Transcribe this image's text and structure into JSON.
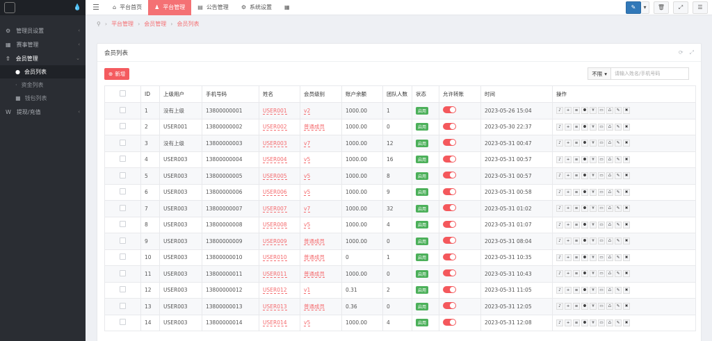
{
  "sidebar": {
    "items": [
      {
        "label": "管理员设置",
        "icon": "wrench-icon"
      },
      {
        "label": "赛事管理",
        "icon": "grid-icon"
      },
      {
        "label": "会员管理",
        "icon": "user-icon"
      },
      {
        "label": "提现/充值",
        "icon": "wallet-icon"
      }
    ],
    "subitems": [
      {
        "label": "会员列表",
        "icon": "users-icon"
      },
      {
        "label": "资金列表",
        "icon": "dot-icon"
      },
      {
        "label": "钱包列表",
        "icon": "wallet-icon"
      }
    ]
  },
  "topbar": {
    "tabs": [
      {
        "label": "平台首页",
        "icon": "home-icon"
      },
      {
        "label": "平台管理",
        "icon": "person-icon"
      },
      {
        "label": "公告管理",
        "icon": "notice-icon"
      },
      {
        "label": "系统设置",
        "icon": "gear-icon"
      }
    ]
  },
  "breadcrumb": [
    "平台管理",
    "会员管理",
    "会员列表"
  ],
  "panel": {
    "title": "会员列表",
    "add_label": "新增",
    "filter_label": "不限",
    "search_placeholder": "请输入姓名/手机号码"
  },
  "table": {
    "headers": [
      "ID",
      "上级用户",
      "手机号码",
      "姓名",
      "会员级别",
      "账户余额",
      "团队人数",
      "状态",
      "允许转账",
      "时间",
      "操作"
    ],
    "status_label": "启用",
    "rows": [
      {
        "id": "1",
        "parent": "没有上级",
        "phone": "13800000001",
        "name": "USER001",
        "level": "v2",
        "balance": "1000.00",
        "team": "1",
        "time": "2023-05-26 15:04"
      },
      {
        "id": "2",
        "parent": "USER001",
        "phone": "13800000002",
        "name": "USER002",
        "level": "普通成员",
        "balance": "1000.00",
        "team": "0",
        "time": "2023-05-30 22:37"
      },
      {
        "id": "3",
        "parent": "没有上级",
        "phone": "13800000003",
        "name": "USER003",
        "level": "v7",
        "balance": "1000.00",
        "team": "12",
        "time": "2023-05-31 00:47"
      },
      {
        "id": "4",
        "parent": "USER003",
        "phone": "13800000004",
        "name": "USER004",
        "level": "v5",
        "balance": "1000.00",
        "team": "16",
        "time": "2023-05-31 00:57"
      },
      {
        "id": "5",
        "parent": "USER003",
        "phone": "13800000005",
        "name": "USER005",
        "level": "v5",
        "balance": "1000.00",
        "team": "8",
        "time": "2023-05-31 00:57"
      },
      {
        "id": "6",
        "parent": "USER003",
        "phone": "13800000006",
        "name": "USER006",
        "level": "v5",
        "balance": "1000.00",
        "team": "9",
        "time": "2023-05-31 00:58"
      },
      {
        "id": "7",
        "parent": "USER003",
        "phone": "13800000007",
        "name": "USER007",
        "level": "v7",
        "balance": "1000.00",
        "team": "32",
        "time": "2023-05-31 01:02"
      },
      {
        "id": "8",
        "parent": "USER003",
        "phone": "13800000008",
        "name": "USER008",
        "level": "v5",
        "balance": "1000.00",
        "team": "4",
        "time": "2023-05-31 01:07"
      },
      {
        "id": "9",
        "parent": "USER003",
        "phone": "13800000009",
        "name": "USER009",
        "level": "普通成员",
        "balance": "1000.00",
        "team": "0",
        "time": "2023-05-31 08:04"
      },
      {
        "id": "10",
        "parent": "USER003",
        "phone": "13800000010",
        "name": "USER010",
        "level": "普通成员",
        "balance": "0",
        "team": "1",
        "time": "2023-05-31 10:35"
      },
      {
        "id": "11",
        "parent": "USER003",
        "phone": "13800000011",
        "name": "USER011",
        "level": "普通成员",
        "balance": "1000.00",
        "team": "0",
        "time": "2023-05-31 10:43"
      },
      {
        "id": "12",
        "parent": "USER003",
        "phone": "13800000012",
        "name": "USER012",
        "level": "v1",
        "balance": "0.31",
        "team": "2",
        "time": "2023-05-31 11:05"
      },
      {
        "id": "13",
        "parent": "USER003",
        "phone": "13800000013",
        "name": "USER013",
        "level": "普通成员",
        "balance": "0.36",
        "team": "0",
        "time": "2023-05-31 12:05"
      },
      {
        "id": "14",
        "parent": "USER003",
        "phone": "13800000014",
        "name": "USER014",
        "level": "v5",
        "balance": "1000.00",
        "team": "4",
        "time": "2023-05-31 12:08"
      }
    ],
    "ops": [
      "bell-icon",
      "plus-icon",
      "list-icon",
      "users-icon",
      "yen-icon",
      "card-icon",
      "recycle-icon",
      "edit-icon",
      "delete-icon"
    ]
  }
}
